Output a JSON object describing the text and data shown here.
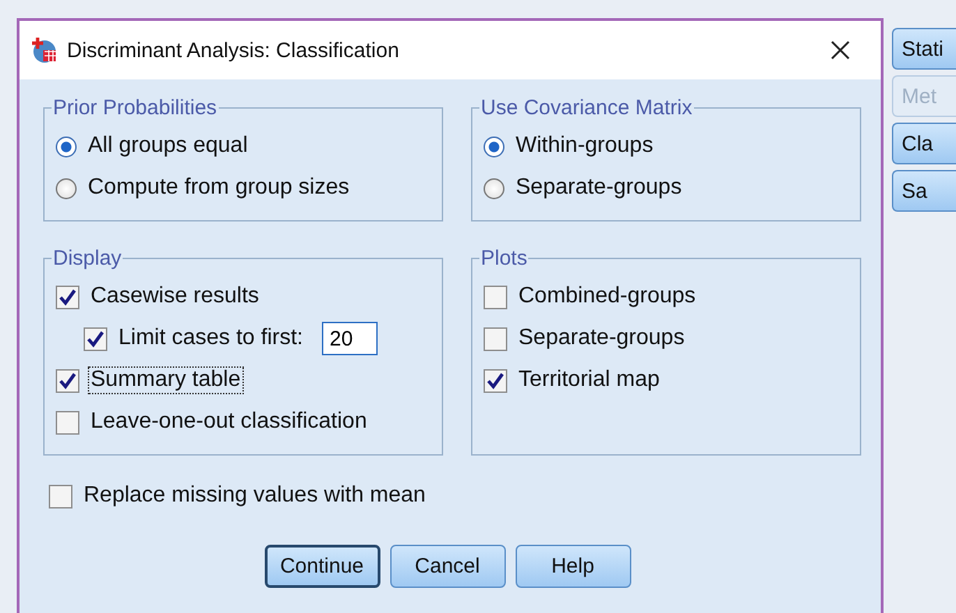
{
  "window": {
    "title": "Discriminant Analysis: Classification"
  },
  "groups": [
    {
      "title": "Prior Probabilities",
      "kind": "radio",
      "items": [
        {
          "label": "All groups equal",
          "selected": true
        },
        {
          "label": "Compute from group sizes",
          "selected": false
        }
      ]
    },
    {
      "title": "Use Covariance Matrix",
      "kind": "radio",
      "items": [
        {
          "label": "Within-groups",
          "selected": true
        },
        {
          "label": "Separate-groups",
          "selected": false
        }
      ]
    },
    {
      "title": "Display",
      "kind": "checkbox",
      "items": [
        {
          "label": "Casewise results",
          "checked": true,
          "focused": false,
          "children": [
            {
              "label": "Limit cases to first:",
              "checked": true,
              "focused": false,
              "value": "20"
            }
          ]
        },
        {
          "label": "Summary table",
          "checked": true,
          "focused": true
        },
        {
          "label": "Leave-one-out classification",
          "checked": false,
          "focused": false
        }
      ]
    },
    {
      "title": "Plots",
      "kind": "checkbox",
      "items": [
        {
          "label": "Combined-groups",
          "checked": false,
          "focused": false
        },
        {
          "label": "Separate-groups",
          "checked": false,
          "focused": false
        },
        {
          "label": "Territorial map",
          "checked": true,
          "focused": false
        }
      ]
    }
  ],
  "options": [
    {
      "label": "Replace missing values with mean",
      "checked": false,
      "focused": false
    }
  ],
  "buttons": [
    {
      "label": "Continue",
      "default": true
    },
    {
      "label": "Cancel",
      "default": false
    },
    {
      "label": "Help",
      "default": false
    }
  ],
  "side_buttons": [
    {
      "label": "Stati",
      "disabled": false
    },
    {
      "label": "Met",
      "disabled": true
    },
    {
      "label": "Cla",
      "disabled": false
    },
    {
      "label": "Sa",
      "disabled": false
    }
  ]
}
